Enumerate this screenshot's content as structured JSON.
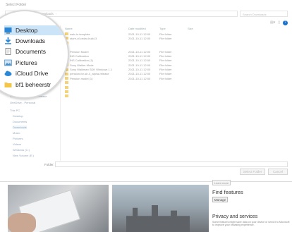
{
  "dialog": {
    "title": "Select Folder",
    "breadcrumb": [
      "This PC",
      "Downloads"
    ],
    "search_placeholder": "Search Downloads",
    "filename_label": "Folder:",
    "select_button": "Select Folder",
    "cancel_button": "Cancel"
  },
  "quick_access": [
    {
      "label": "Desktop",
      "icon": "desktop-icon",
      "selected": true
    },
    {
      "label": "Downloads",
      "icon": "download-arrow-icon",
      "selected": false
    },
    {
      "label": "Documents",
      "icon": "document-icon",
      "selected": false
    },
    {
      "label": "Pictures",
      "icon": "pictures-icon",
      "selected": false
    },
    {
      "label": "iCloud Drive",
      "icon": "icloud-icon",
      "selected": false
    },
    {
      "label": "bf1 beheerstr",
      "icon": "folder-icon",
      "selected": false
    }
  ],
  "nav_small": [
    "OneDrive - Windows Release",
    "OneDrive - Personal",
    "This PC",
    "Desktop",
    "Documents",
    "Downloads",
    "Music",
    "Pictures",
    "Videos",
    "Windows (C:)",
    "New Volume (E:)"
  ],
  "columns": [
    "Name",
    "Date modified",
    "Type",
    "Size"
  ],
  "files": [
    {
      "name": "web-to-template",
      "date": "2021-10-11 12:00",
      "type": "File folder"
    },
    {
      "name": "store-of-cedar-build-3",
      "date": "2021-10-11 12:00",
      "type": "File folder"
    },
    {
      "name": "",
      "date": "",
      "type": ""
    },
    {
      "name": "",
      "date": "",
      "type": ""
    },
    {
      "name": "Pension Model",
      "date": "2021-10-11 12:00",
      "type": "File folder"
    },
    {
      "name": "INS Calibration",
      "date": "2021-10-11 12:00",
      "type": "File folder"
    },
    {
      "name": "INS Calibration (1)",
      "date": "2021-10-11 12:00",
      "type": "File folder"
    },
    {
      "name": "Sony Walker Mode",
      "date": "2021-10-11 12:00",
      "type": "File folder"
    },
    {
      "name": "Sony Walkman SDK Windows 1.1",
      "date": "2021-10-11 12:00",
      "type": "File folder"
    },
    {
      "name": "pension-for-sir-4_alpha-release",
      "date": "2021-10-11 12:00",
      "type": "File folder"
    },
    {
      "name": "Pension model (1)",
      "date": "2021-10-11 12:00",
      "type": "File folder"
    },
    {
      "name": "",
      "date": "",
      "type": ""
    },
    {
      "name": "",
      "date": "",
      "type": ""
    },
    {
      "name": "",
      "date": "",
      "type": ""
    },
    {
      "name": "",
      "date": "",
      "type": ""
    }
  ],
  "below": {
    "side_button": "Learn more",
    "find_title": "Find features",
    "manage_button": "Manage",
    "privacy_title": "Privacy and services",
    "privacy_text": "Some features might save data on your device or send it to Microsoft to improve your browsing experience."
  }
}
